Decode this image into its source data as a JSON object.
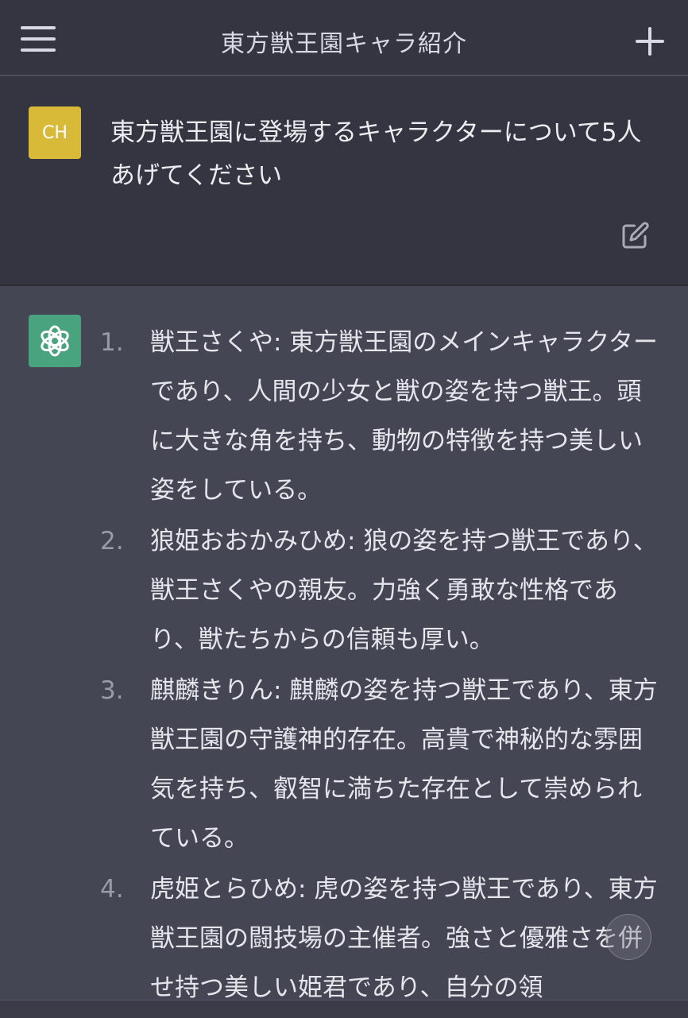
{
  "header": {
    "title": "東方獣王園キャラ紹介"
  },
  "user_message": {
    "avatar_initials": "CH",
    "text": "東方獣王園に登場するキャラクターについて5人あげてください"
  },
  "assistant_message": {
    "items": [
      {
        "number": "1.",
        "text": "獣王さくや: 東方獣王園のメインキャラクターであり、人間の少女と獣の姿を持つ獣王。頭に大きな角を持ち、動物の特徴を持つ美しい姿をしている。"
      },
      {
        "number": "2.",
        "text": "狼姫おおかみひめ: 狼の姿を持つ獣王であり、獣王さくやの親友。力強く勇敢な性格であり、獣たちからの信頼も厚い。"
      },
      {
        "number": "3.",
        "text": "麒麟きりん: 麒麟の姿を持つ獣王であり、東方獣王園の守護神的存在。高貴で神秘的な雰囲気を持ち、叡智に満ちた存在として崇められている。"
      },
      {
        "number": "4.",
        "text": "虎姫とらひめ: 虎の姿を持つ獣王であり、東方獣王園の闘技場の主催者。強さと優雅さを併せ持つ美しい姫君であり、自分の領"
      }
    ]
  },
  "colors": {
    "background": "#343541",
    "assistant_background": "#444654",
    "user_avatar": "#d9b938",
    "assistant_avatar": "#4aa37f"
  }
}
